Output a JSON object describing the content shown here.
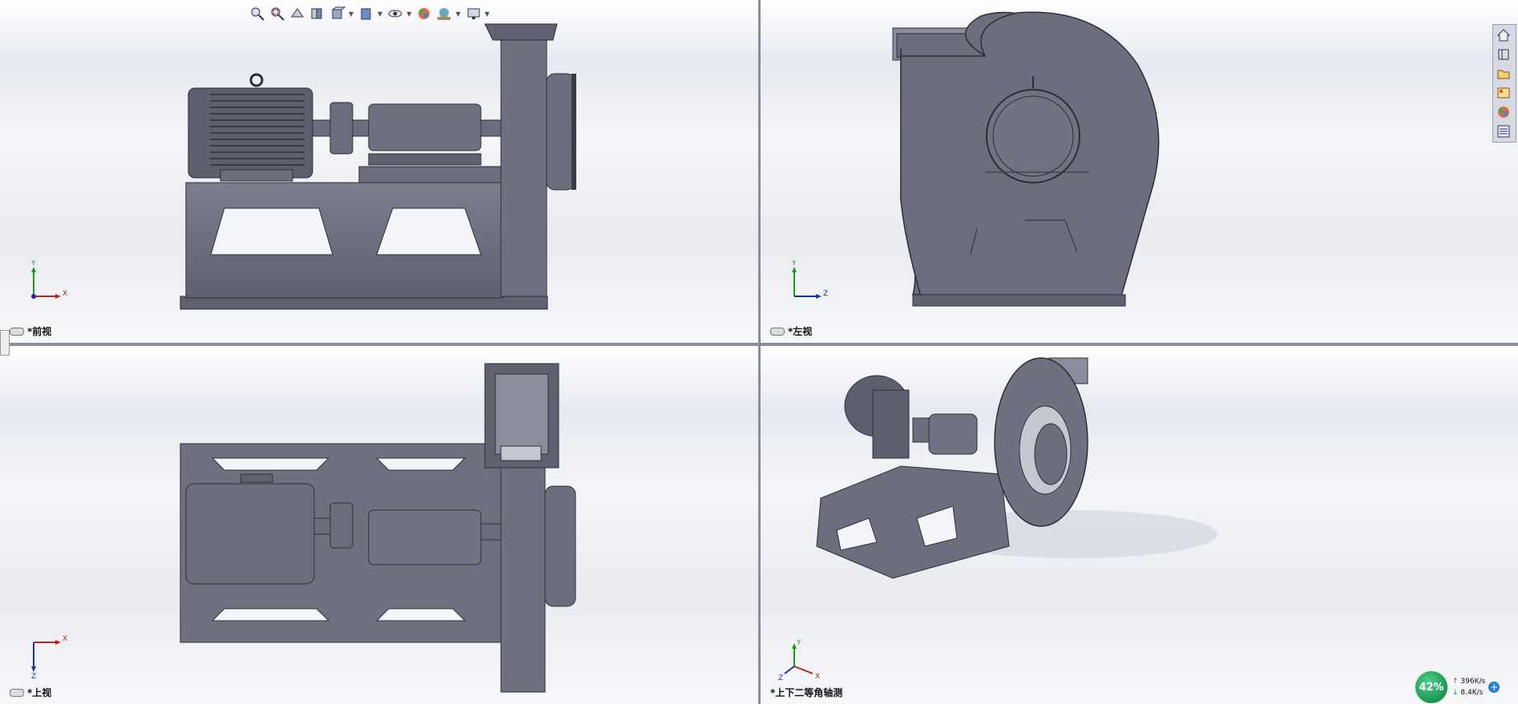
{
  "viewports": {
    "front": {
      "label": "*前视",
      "axes": [
        "Y",
        "X"
      ]
    },
    "left": {
      "label": "*左视",
      "axes": [
        "Y",
        "Z"
      ]
    },
    "top": {
      "label": "*上视",
      "axes": [
        "X",
        "Z"
      ]
    },
    "iso": {
      "label": "*上下二等角轴测",
      "axes": [
        "Y",
        "X",
        "Z"
      ]
    }
  },
  "toolbar": {
    "icons": [
      "zoom-to-fit-icon",
      "zoom-area-icon",
      "previous-view-icon",
      "section-view-icon",
      "view-orientation-icon",
      "display-style-icon",
      "hide-show-icon",
      "appearance-icon",
      "scene-icon",
      "display-settings-icon"
    ]
  },
  "taskpane": {
    "icons": [
      "home-icon",
      "design-library-icon",
      "file-explorer-icon",
      "view-palette-icon",
      "appearances-icon",
      "custom-properties-icon"
    ]
  },
  "netmon": {
    "percent": "42%",
    "upload": "396K/s",
    "download": "8.4K/s",
    "up_arrow": "↑",
    "down_arrow": "↓",
    "plus": "+"
  },
  "colors": {
    "model": "#6b6e7c",
    "model_dark": "#3a3c45",
    "model_light": "#8c8f9c"
  }
}
